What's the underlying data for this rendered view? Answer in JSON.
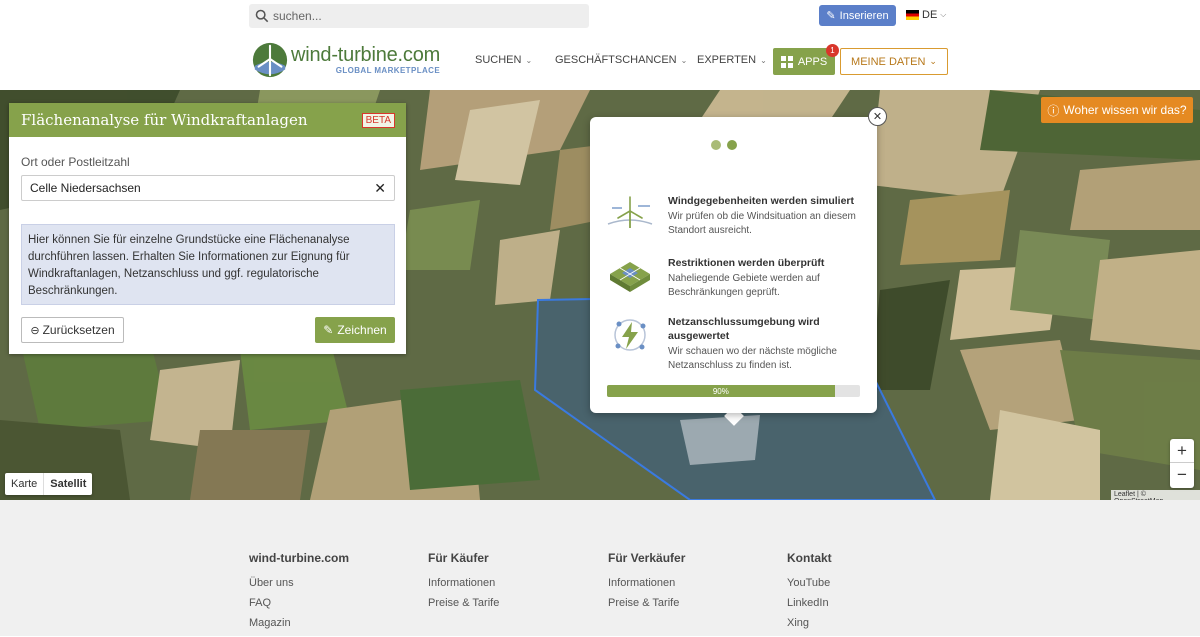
{
  "header": {
    "search_placeholder": "suchen...",
    "inserieren": "Inserieren",
    "language": "DE",
    "logo_title": "wind-turbine.com",
    "logo_subtitle": "GLOBAL MARKETPLACE",
    "nav": [
      "SUCHEN",
      "GESCHÄFTSCHANCEN",
      "EXPERTEN"
    ],
    "apps_label": "APPS",
    "apps_badge": "1",
    "meine_daten": "MEINE DATEN",
    "accent_color": "#86a24b"
  },
  "panel": {
    "title": "Flächenanalyse für Windkraftanlagen",
    "beta": "BETA",
    "ort_label": "Ort oder Postleitzahl",
    "ort_value": "Celle Niedersachsen",
    "info_text": "Hier können Sie für einzelne Grundstücke eine Flächenanalyse durchführen lassen. Erhalten Sie Informationen zur Eignung für Windkraftanlagen, Netzanschluss und ggf. regulatorische Beschränkungen.",
    "reset_label": "Zurücksetzen",
    "draw_label": "Zeichnen"
  },
  "woher_label": "Woher wissen wir das?",
  "popup": {
    "steps": [
      {
        "title": "Windgegebenheiten werden simuliert",
        "desc": "Wir prüfen ob die Windsituation an diesem Standort ausreicht.",
        "icon": "wind-turbine-icon"
      },
      {
        "title": "Restriktionen werden überprüft",
        "desc": "Naheliegende Gebiete werden auf Beschränkungen geprüft.",
        "icon": "area-grid-icon"
      },
      {
        "title": "Netzanschlussumgebung wird ausgewertet",
        "desc": "Wir schauen wo der nächste mögliche Netzanschluss zu finden ist.",
        "icon": "power-bolt-icon"
      }
    ],
    "progress_label": "90%",
    "progress_value": 0.9
  },
  "map": {
    "toggle_karte": "Karte",
    "toggle_satellit": "Satellit",
    "zoom_in": "+",
    "zoom_out": "−",
    "attribution": "Leaflet | © OpenStreetMap"
  },
  "footer": {
    "columns": [
      {
        "heading": "wind-turbine.com",
        "links": [
          "Über uns",
          "FAQ",
          "Magazin"
        ]
      },
      {
        "heading": "Für Käufer",
        "links": [
          "Informationen",
          "Preise & Tarife"
        ]
      },
      {
        "heading": "Für Verkäufer",
        "links": [
          "Informationen",
          "Preise & Tarife"
        ]
      },
      {
        "heading": "Kontakt",
        "links": [
          "YouTube",
          "LinkedIn",
          "Xing"
        ]
      }
    ]
  }
}
